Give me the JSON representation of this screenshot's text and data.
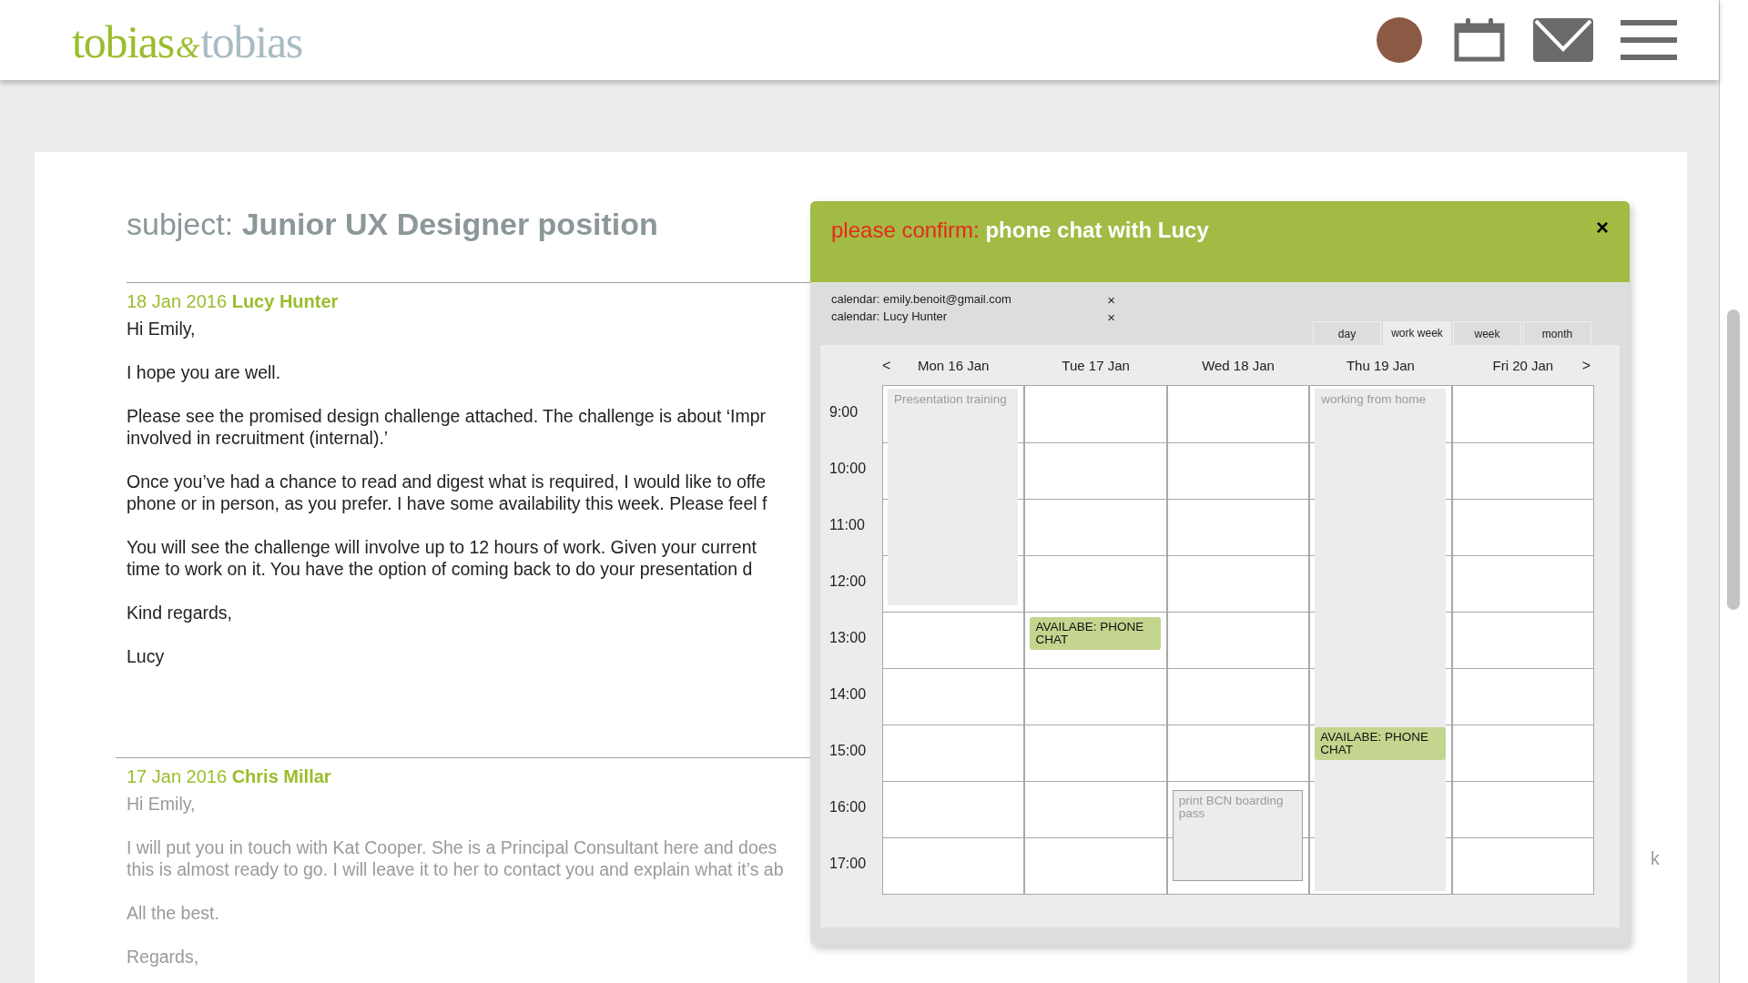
{
  "logo": {
    "first": "tobias",
    "amp": "&",
    "second": "tobias"
  },
  "email": {
    "subject_label": "subject:",
    "subject": "Junior UX Designer position",
    "messages": [
      {
        "date": "18 Jan 2016",
        "sender": "Lucy Hunter",
        "muted": false,
        "paragraphs": [
          [
            "Hi Emily,"
          ],
          [
            "I hope you are well."
          ],
          [
            "Please see the promised design challenge attached. The challenge is about ‘Impr",
            "involved in recruitment (internal).’"
          ],
          [
            "Once you’ve had a chance to read and digest what is required, I would like to offe",
            "phone or in person, as you prefer. I have some availability this week. Please feel f"
          ],
          [
            "You will see the challenge will involve up to 12 hours of work. Given your current",
            "time to work on it. You have the option of coming back to do your presentation d"
          ],
          [
            "Kind regards,"
          ],
          [
            "Lucy"
          ]
        ]
      },
      {
        "date": "17 Jan 2016",
        "sender": "Chris Millar",
        "muted": true,
        "fragment": "k",
        "paragraphs": [
          [
            "Hi Emily,"
          ],
          [
            "I will put you in touch with Kat Cooper. She is a Principal Consultant here and does",
            "this is almost ready to go. I will leave it to her to contact you and explain what it’s ab"
          ],
          [
            "All the best."
          ],
          [
            "Regards,"
          ]
        ]
      }
    ]
  },
  "popup": {
    "prefix": "please confirm:",
    "title": "phone chat with Lucy",
    "close": "×",
    "calendars": [
      {
        "label": "calendar: emily.benoit@gmail.com",
        "remove": "×"
      },
      {
        "label": "calendar: Lucy Hunter",
        "remove": "×"
      }
    ],
    "views": [
      {
        "label": "day",
        "selected": false
      },
      {
        "label": "work week",
        "selected": true
      },
      {
        "label": "week",
        "selected": false
      },
      {
        "label": "month",
        "selected": false
      }
    ],
    "prev": "<",
    "next": ">",
    "hours": [
      "9:00",
      "10:00",
      "11:00",
      "12:00",
      "13:00",
      "14:00",
      "15:00",
      "16:00",
      "17:00"
    ],
    "days": [
      {
        "label": "Mon 16 Jan",
        "events": [
          {
            "kind": "busy",
            "text": "Presentation training"
          }
        ]
      },
      {
        "label": "Tue 17 Jan",
        "events": [
          {
            "kind": "available",
            "text": "AVAILABE: PHONE CHAT"
          }
        ]
      },
      {
        "label": "Wed 18 Jan",
        "events": [
          {
            "kind": "outlined",
            "text": "print BCN boarding pass"
          }
        ]
      },
      {
        "label": "Thu 19 Jan",
        "events": [
          {
            "kind": "busy",
            "text": "working from home"
          },
          {
            "kind": "available",
            "text": "AVAILABE: PHONE CHAT"
          }
        ]
      },
      {
        "label": "Fri 20 Jan"
      }
    ]
  }
}
